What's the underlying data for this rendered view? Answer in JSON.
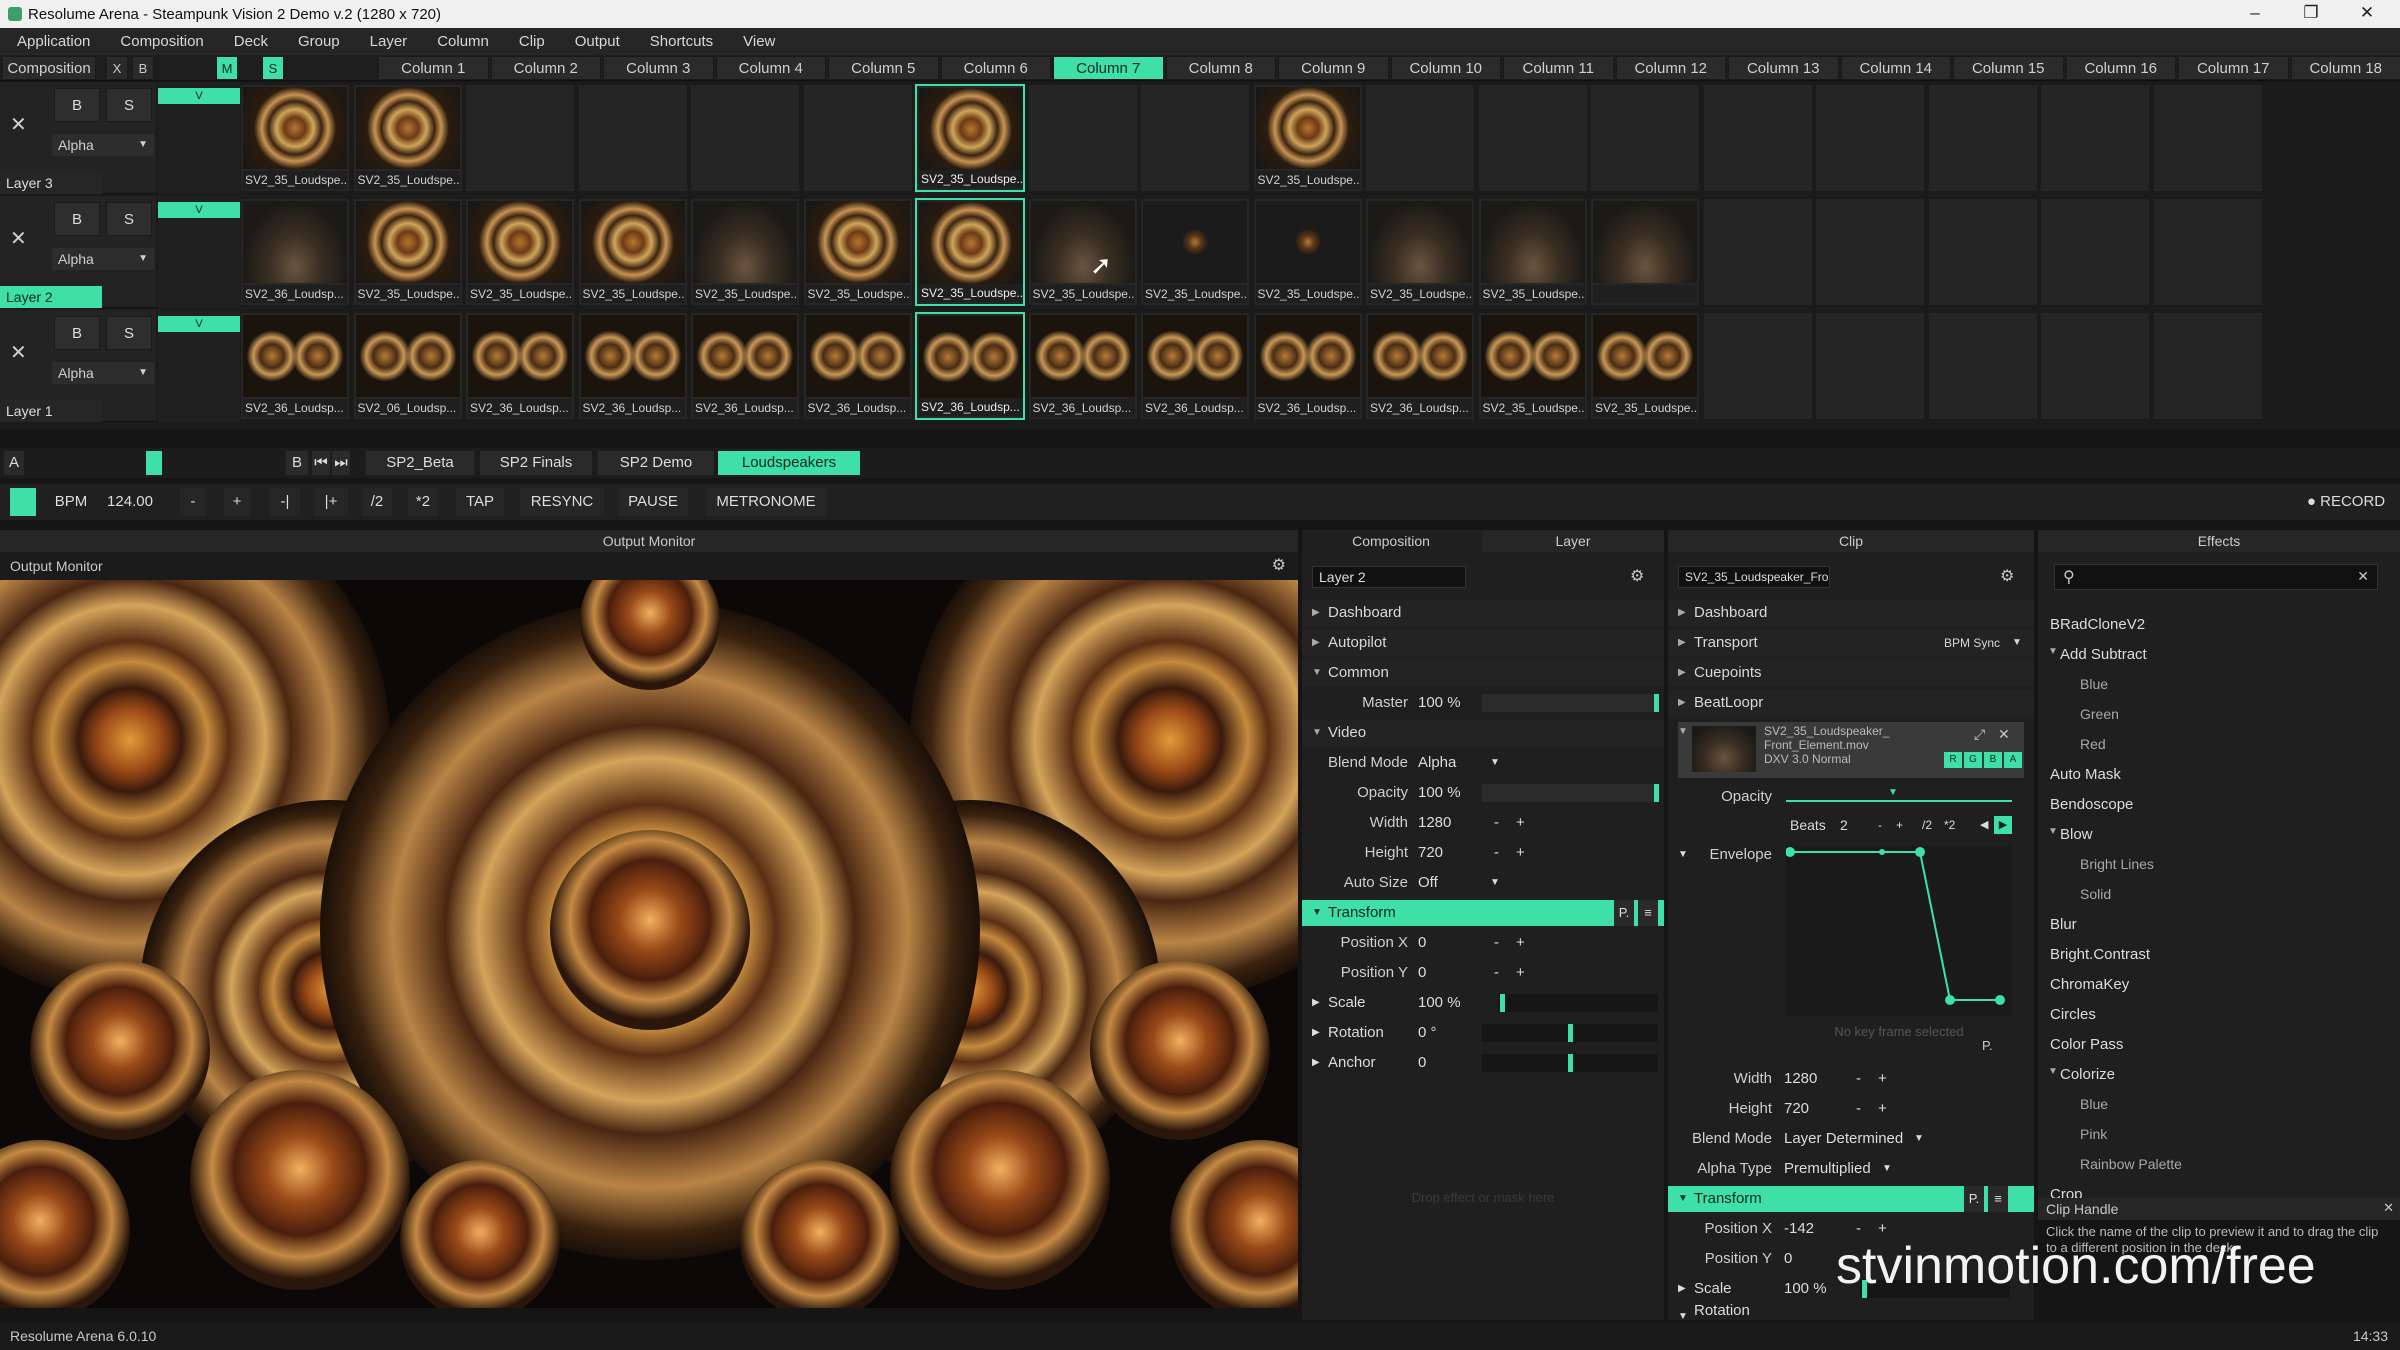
{
  "window": {
    "title": "Resolume Arena - Steampunk Vision 2 Demo v.2 (1280 x 720)",
    "minimize": "–",
    "maximize": "❐",
    "close": "✕"
  },
  "menu": [
    "Application",
    "Composition",
    "Deck",
    "Group",
    "Layer",
    "Column",
    "Clip",
    "Output",
    "Shortcuts",
    "View"
  ],
  "composition_header": {
    "label": "Composition",
    "x": "X",
    "b": "B",
    "m": "M",
    "s": "S"
  },
  "columns": [
    "Column 1",
    "Column 2",
    "Column 3",
    "Column 4",
    "Column 5",
    "Column 6",
    "Column 7",
    "Column 8",
    "Column 9",
    "Column 10",
    "Column 11",
    "Column 12",
    "Column 13",
    "Column 14",
    "Column 15",
    "Column 16",
    "Column 17",
    "Column 18"
  ],
  "active_column": "Column 7",
  "layers": [
    {
      "name": "Layer 3",
      "blend": "Alpha",
      "b": "B",
      "s": "S",
      "a": "A",
      "bb": "B",
      "v": "V",
      "x": "✕",
      "clips": [
        "SV2_35_Loudspe...",
        "SV2_35_Loudspe...",
        "",
        "",
        "",
        "",
        "SV2_35_Loudspe...",
        "",
        "",
        "SV2_35_Loudspe...",
        "",
        "",
        "",
        "",
        "",
        "",
        "",
        ""
      ]
    },
    {
      "name": "Layer 2",
      "blend": "Alpha",
      "b": "B",
      "s": "S",
      "a": "A",
      "bb": "B",
      "v": "V",
      "x": "✕",
      "clips": [
        "SV2_36_Loudsp...",
        "SV2_35_Loudspe...",
        "SV2_35_Loudspe...",
        "SV2_35_Loudspe...",
        "SV2_35_Loudspe...",
        "SV2_35_Loudspe...",
        "SV2_35_Loudspe...",
        "SV2_35_Loudspe...",
        "SV2_35_Loudspe...",
        "SV2_35_Loudspe...",
        "SV2_35_Loudspe...",
        "SV2_35_Loudspe...",
        "",
        "",
        "",
        "",
        "",
        ""
      ]
    },
    {
      "name": "Layer 1",
      "blend": "Alpha",
      "b": "B",
      "s": "S",
      "a": "A",
      "bb": "B",
      "v": "V",
      "x": "✕",
      "clips": [
        "SV2_36_Loudsp...",
        "SV2_06_Loudsp...",
        "SV2_36_Loudsp...",
        "SV2_36_Loudsp...",
        "SV2_36_Loudsp...",
        "SV2_36_Loudsp...",
        "SV2_36_Loudsp...",
        "SV2_36_Loudsp...",
        "SV2_36_Loudsp...",
        "SV2_36_Loudsp...",
        "SV2_36_Loudsp...",
        "SV2_35_Loudspe...",
        "SV2_35_Loudspe...",
        "",
        "",
        "",
        "",
        ""
      ]
    }
  ],
  "clip_names_row2_first": "SV2_35_Loudspe...",
  "deck_controls": {
    "a": "A",
    "b": "B"
  },
  "decks": [
    "SP2_Beta",
    "SP2 Finals",
    "SP2 Demo",
    "Loudspeakers"
  ],
  "active_deck": "Loudspeakers",
  "bpm": {
    "label": "BPM",
    "value": "124.00",
    "minus": "-",
    "plus": "+",
    "nudge_minus": "-|",
    "nudge_plus": "|+",
    "half": "/2",
    "double": "*2",
    "tap": "TAP",
    "resync": "RESYNC",
    "pause": "PAUSE",
    "metronome": "METRONOME",
    "record": "RECORD"
  },
  "output_monitor": {
    "header": "Output Monitor",
    "title": "Output Monitor"
  },
  "layer_panel": {
    "tabs": [
      "Composition",
      "Layer"
    ],
    "name": "Layer 2",
    "sections": {
      "dashboard": "Dashboard",
      "autopilot": "Autopilot",
      "common": "Common",
      "video": "Video",
      "transform": "Transform"
    },
    "master": {
      "label": "Master",
      "value": "100 %"
    },
    "blend_mode": {
      "label": "Blend Mode",
      "value": "Alpha"
    },
    "opacity": {
      "label": "Opacity",
      "value": "100 %"
    },
    "width": {
      "label": "Width",
      "value": "1280"
    },
    "height": {
      "label": "Height",
      "value": "720"
    },
    "auto_size": {
      "label": "Auto Size",
      "value": "Off"
    },
    "position_x": {
      "label": "Position X",
      "value": "0"
    },
    "position_y": {
      "label": "Position Y",
      "value": "0"
    },
    "scale": {
      "label": "Scale",
      "value": "100 %"
    },
    "rotation": {
      "label": "Rotation",
      "value": "0 °"
    },
    "anchor": {
      "label": "Anchor",
      "value": "0"
    },
    "p_btn": "P.",
    "menu_btn": "≡",
    "drop_hint": "Drop effect or mask here"
  },
  "clip_panel": {
    "header": "Clip",
    "name": "SV2_35_Loudspeaker_Fro...",
    "sections": {
      "dashboard": "Dashboard",
      "transport": "Transport",
      "cuepoints": "Cuepoints",
      "beatloopr": "BeatLoopr",
      "transform": "Transform"
    },
    "transport_mode": "BPM Sync",
    "file_name": "SV2_35_Loudspeaker_",
    "file_name2": "Front_Element.mov",
    "codec": "DXV 3.0 Normal",
    "rgba": [
      "R",
      "G",
      "B",
      "A"
    ],
    "opacity_label": "Opacity",
    "beats_label": "Beats",
    "beats_value": "2",
    "beats_btns": [
      "-",
      "+",
      "/2",
      "*2"
    ],
    "envelope_label": "Envelope",
    "no_key": "No key frame selected",
    "p_btn": "P.",
    "width": {
      "label": "Width",
      "value": "1280"
    },
    "height": {
      "label": "Height",
      "value": "720"
    },
    "blend_mode": {
      "label": "Blend Mode",
      "value": "Layer Determined"
    },
    "alpha_type": {
      "label": "Alpha Type",
      "value": "Premultiplied"
    },
    "position_x": {
      "label": "Position X",
      "value": "-142"
    },
    "position_y": {
      "label": "Position Y",
      "value": "0"
    },
    "scale": {
      "label": "Scale",
      "value": "100 %"
    },
    "rotation": {
      "label": "Rotation",
      "value": ""
    },
    "menu_btn": "≡"
  },
  "effects": {
    "header": "Effects",
    "search_placeholder": "",
    "clear": "✕",
    "items": [
      {
        "label": "BRadCloneV2",
        "kind": "item"
      },
      {
        "label": "Add Subtract",
        "kind": "group"
      },
      {
        "label": "Blue",
        "kind": "sub"
      },
      {
        "label": "Green",
        "kind": "sub"
      },
      {
        "label": "Red",
        "kind": "sub"
      },
      {
        "label": "Auto Mask",
        "kind": "item"
      },
      {
        "label": "Bendoscope",
        "kind": "item"
      },
      {
        "label": "Blow",
        "kind": "group"
      },
      {
        "label": "Bright Lines",
        "kind": "sub"
      },
      {
        "label": "Solid",
        "kind": "sub"
      },
      {
        "label": "Blur",
        "kind": "item"
      },
      {
        "label": "Bright.Contrast",
        "kind": "item"
      },
      {
        "label": "ChromaKey",
        "kind": "item"
      },
      {
        "label": "Circles",
        "kind": "item"
      },
      {
        "label": "Color Pass",
        "kind": "item"
      },
      {
        "label": "Colorize",
        "kind": "group"
      },
      {
        "label": "Blue",
        "kind": "sub"
      },
      {
        "label": "Pink",
        "kind": "sub"
      },
      {
        "label": "Rainbow Palette",
        "kind": "sub"
      },
      {
        "label": "Crop",
        "kind": "item"
      }
    ],
    "tooltip_title": "Clip Handle",
    "tooltip_text": "Click the name of the clip to preview it and to drag the clip to a different position in the deck.",
    "tooltip_close": "✕"
  },
  "watermark": "stvinmotion.com/free",
  "status": {
    "version": "Resolume Arena 6.0.10",
    "time": "14:33"
  },
  "colors": {
    "accent": "#3fe0a8",
    "background": "#151515",
    "panel": "#1f1f1f"
  }
}
